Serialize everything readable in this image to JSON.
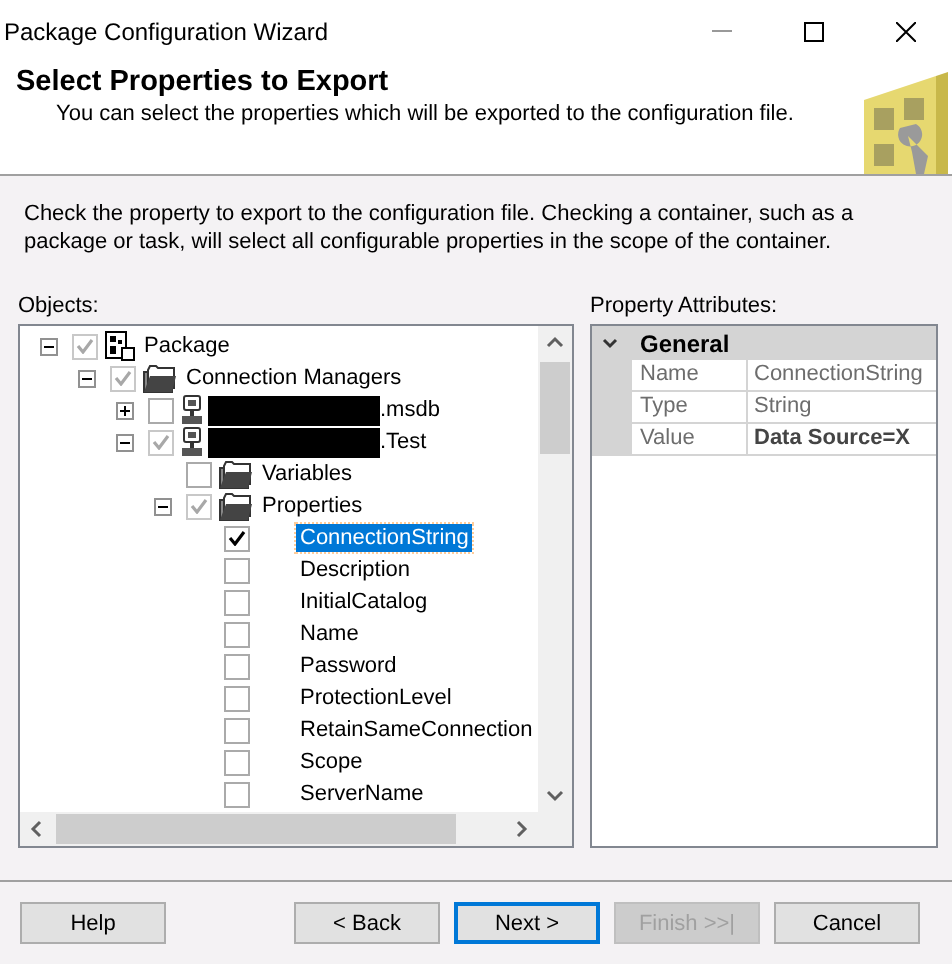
{
  "window": {
    "title": "Package Configuration Wizard"
  },
  "header": {
    "title": "Select Properties to Export",
    "subtitle": "You can select the properties which will be exported to the configuration file."
  },
  "instructions": "Check the property to export to the configuration file. Checking a container, such as a package or task, will select all configurable properties in the scope of the container.",
  "objects": {
    "label": "Objects:",
    "tree": [
      {
        "label": "Package",
        "kind": "package",
        "checked": true,
        "greyed": true,
        "expanded": true,
        "selected": false,
        "children": [
          {
            "label": "Connection Managers",
            "kind": "folder",
            "checked": true,
            "greyed": true,
            "expanded": true,
            "selected": false,
            "children": [
              {
                "label": ".msdb",
                "kind": "connection",
                "checked": false,
                "greyed": false,
                "expanded": false,
                "redacted": true,
                "selected": false
              },
              {
                "label": ".Test",
                "kind": "connection",
                "checked": true,
                "greyed": true,
                "expanded": true,
                "redacted": true,
                "selected": false,
                "children": [
                  {
                    "label": "Variables",
                    "kind": "folder",
                    "checked": false,
                    "greyed": false,
                    "selected": false
                  },
                  {
                    "label": "Properties",
                    "kind": "folder",
                    "checked": true,
                    "greyed": true,
                    "expanded": true,
                    "selected": false,
                    "children": [
                      {
                        "label": "ConnectionString",
                        "kind": "property",
                        "checked": true,
                        "greyed": false,
                        "selected": true
                      },
                      {
                        "label": "Description",
                        "kind": "property",
                        "checked": false,
                        "greyed": false,
                        "selected": false
                      },
                      {
                        "label": "InitialCatalog",
                        "kind": "property",
                        "checked": false,
                        "greyed": false,
                        "selected": false
                      },
                      {
                        "label": "Name",
                        "kind": "property",
                        "checked": false,
                        "greyed": false,
                        "selected": false
                      },
                      {
                        "label": "Password",
                        "kind": "property",
                        "checked": false,
                        "greyed": false,
                        "selected": false
                      },
                      {
                        "label": "ProtectionLevel",
                        "kind": "property",
                        "checked": false,
                        "greyed": false,
                        "selected": false
                      },
                      {
                        "label": "RetainSameConnection",
                        "kind": "property",
                        "checked": false,
                        "greyed": false,
                        "selected": false
                      },
                      {
                        "label": "Scope",
                        "kind": "property",
                        "checked": false,
                        "greyed": false,
                        "selected": false
                      },
                      {
                        "label": "ServerName",
                        "kind": "property",
                        "checked": false,
                        "greyed": false,
                        "selected": false
                      }
                    ]
                  }
                ]
              }
            ]
          }
        ]
      }
    ]
  },
  "attributes": {
    "label": "Property Attributes:",
    "category": "General",
    "expanded": true,
    "rows": [
      {
        "name": "Name",
        "value": "ConnectionString",
        "bold": false
      },
      {
        "name": "Type",
        "value": "String",
        "bold": false
      },
      {
        "name": "Value",
        "value": "Data Source=X",
        "bold": true
      }
    ]
  },
  "buttons": [
    {
      "label": "Help",
      "default": false,
      "disabled": false
    },
    {
      "label": "< Back",
      "default": false,
      "disabled": false
    },
    {
      "label": "Next >",
      "default": true,
      "disabled": false
    },
    {
      "label": "Finish >>|",
      "default": false,
      "disabled": true
    },
    {
      "label": "Cancel",
      "default": false,
      "disabled": false
    }
  ]
}
